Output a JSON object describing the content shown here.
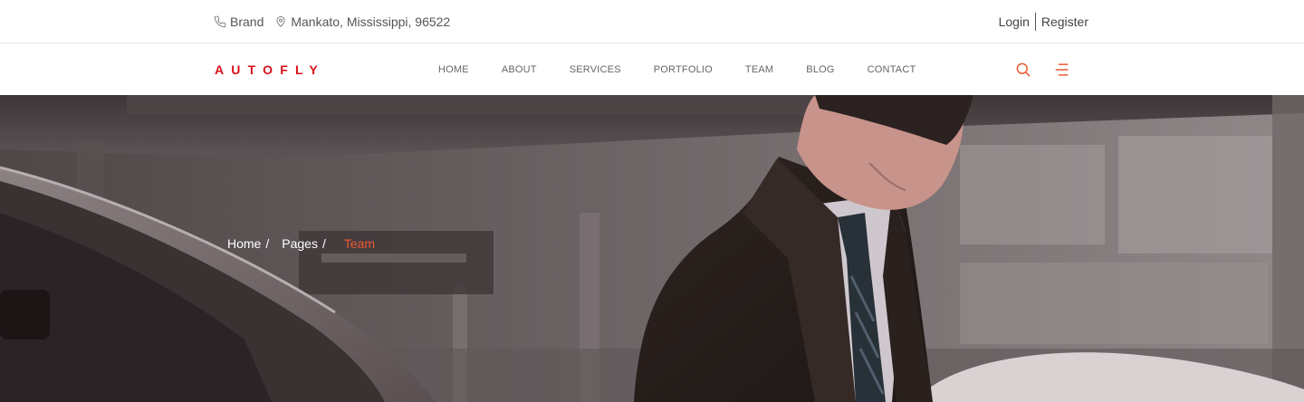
{
  "topbar": {
    "brand": "Brand",
    "address": "Mankato, Mississippi, 96522",
    "login": "Login",
    "register": "Register"
  },
  "navbar": {
    "logo": "AUTOFLY",
    "menu": [
      "HOME",
      "ABOUT",
      "SERVICES",
      "PORTFOLIO",
      "TEAM",
      "BLOG",
      "CONTACT"
    ],
    "icons": [
      "search-icon",
      "menu-icon"
    ],
    "accent_color": "#ef5a36",
    "logo_color": "#d8121b"
  },
  "hero": {
    "breadcrumb": {
      "home": "Home",
      "pages": "Pages",
      "separator": "/",
      "current": "Team"
    },
    "current_color": "#ef5a36"
  }
}
